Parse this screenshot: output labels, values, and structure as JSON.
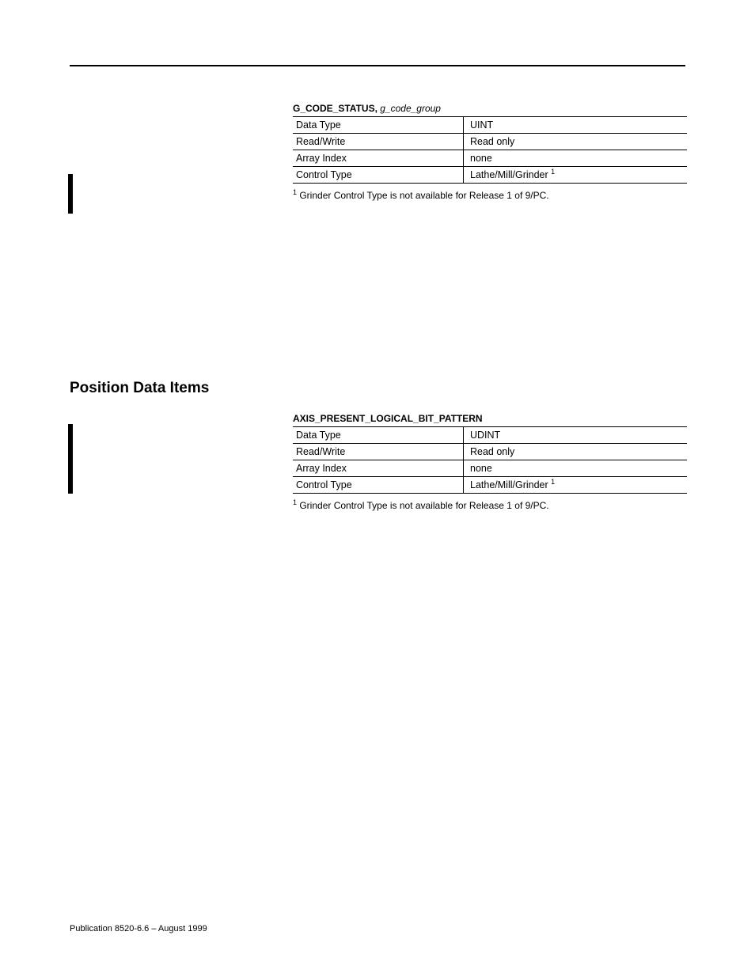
{
  "section_heading": "Position Data Items",
  "table1": {
    "title_prefix": "G_CODE_STATUS,",
    "title_param": "g_code_group",
    "rows": [
      {
        "label": "Data Type",
        "value": "UINT"
      },
      {
        "label": "Read/Write",
        "value": "Read only"
      },
      {
        "label": "Array Index",
        "value": "none"
      },
      {
        "label": "Control Type",
        "value": "Lathe/Mill/Grinder",
        "sup": "1"
      }
    ],
    "footnote_sup": "1",
    "footnote": " Grinder Control Type is not available for Release 1 of 9/PC."
  },
  "table2": {
    "title_full": "AXIS_PRESENT_LOGICAL_BIT_PATTERN",
    "rows": [
      {
        "label": "Data Type",
        "value": "UDINT"
      },
      {
        "label": "Read/Write",
        "value": "Read only"
      },
      {
        "label": "Array Index",
        "value": "none"
      },
      {
        "label": "Control Type",
        "value": "Lathe/Mill/Grinder",
        "sup": "1"
      }
    ],
    "footnote_sup": "1",
    "footnote": " Grinder Control Type is not available for Release 1 of 9/PC."
  },
  "publication": "Publication 8520-6.6 – August 1999"
}
